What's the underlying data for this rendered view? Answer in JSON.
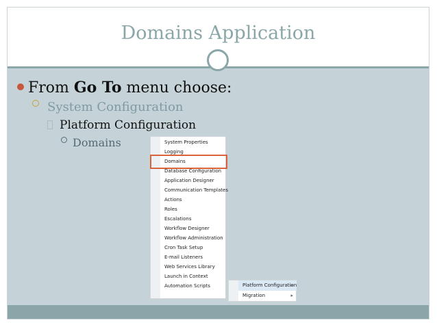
{
  "slide": {
    "title": "Domains Application",
    "bullet1_prefix": "From ",
    "bullet1_bold": "Go To",
    "bullet1_suffix": " menu choose:",
    "bullet2": "System Configuration",
    "bullet3": "Platform Configuration",
    "bullet4": "Domains"
  },
  "menu": {
    "items": [
      "System Properties",
      "Logging",
      "Domains",
      "Database Configuration",
      "Application Designer",
      "Communication Templates",
      "Actions",
      "Roles",
      "Escalations",
      "Workflow Designer",
      "Workflow Administration",
      "Cron Task Setup",
      "E-mail Listeners",
      "Web Services Library",
      "Launch in Context",
      "Automation Scripts"
    ],
    "highlighted": "Domains"
  },
  "submenu": {
    "items": [
      "Platform Configuration",
      "Migration"
    ],
    "selected": "Platform Configuration",
    "arrow": "▸"
  },
  "colors": {
    "accent": "#8aa6a8",
    "content_bg": "#c5d2d8",
    "bullet_dot": "#c8563b",
    "highlight_border": "#d9613c"
  }
}
